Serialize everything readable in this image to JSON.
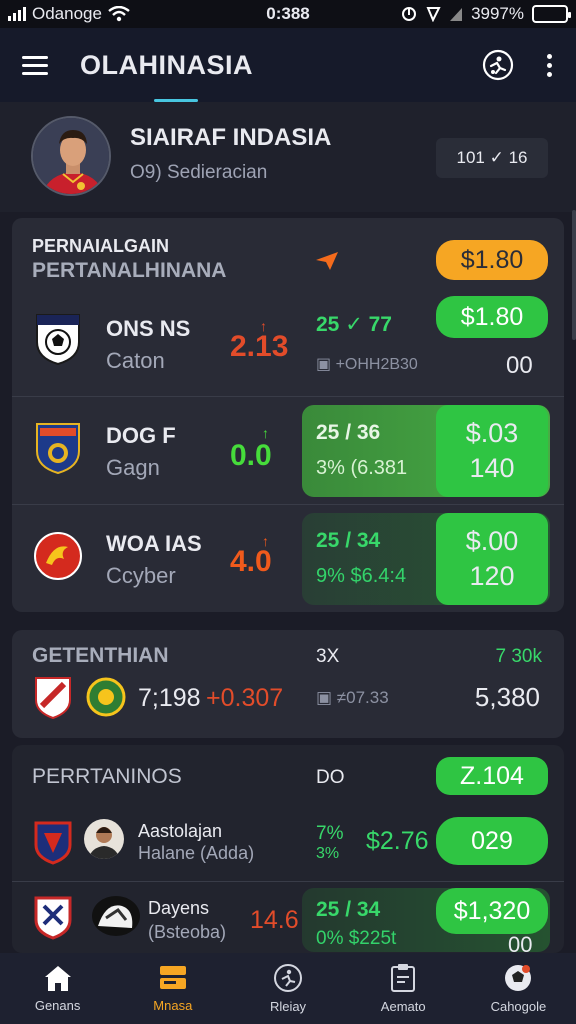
{
  "status_bar": {
    "carrier": "Odanoge",
    "time": "0:388",
    "battery": "3997%",
    "icons": [
      "signal-icon",
      "wifi-icon",
      "sync-icon",
      "location-icon",
      "cellular-icon",
      "battery-icon"
    ]
  },
  "app_bar": {
    "title": "OLAHINASIA",
    "icons": [
      "menu-icon",
      "ball-player-icon",
      "more-icon"
    ],
    "accent": "#48c6e0"
  },
  "profile": {
    "name": "SIAIRAF INDASIA",
    "subtitle": "O9) Sedieracian",
    "stat": "101 ✓ 16"
  },
  "section1": {
    "title": "PERNAIALGAIN",
    "subtitle": "PERTANALHINANA",
    "badge_orange": "$1.80",
    "matches": [
      {
        "team1": "ONS NS",
        "team2": "Caton",
        "score": "2.13",
        "score_mark": "↑",
        "odds_line1": "25 ✓ 77",
        "odds_line2": "▣ +ΟΗΗ2Β30",
        "pill": "$1.80",
        "value": "00"
      },
      {
        "team1": "DOG F",
        "team2": "Gagn",
        "score": "0.0",
        "score_mark": "↑",
        "odds_line1": "25 / 36",
        "odds_line2": "3% (6.381",
        "pill_top": "$.03",
        "pill_bottom": "140"
      },
      {
        "team1": "WOA IAS",
        "team2": "Ccyber",
        "score": "4.0",
        "score_mark": "↑",
        "odds_line1": "25 / 34",
        "odds_line2": "9% $6.4:4",
        "pill_top": "$.00",
        "pill_bottom": "120"
      }
    ]
  },
  "section2": {
    "title": "GETENTHIAN",
    "col1": "3X",
    "col2": "7 30k",
    "score": "7;198",
    "delta": "+0.307",
    "odds": "▣ ≠07.33",
    "total": "5,380"
  },
  "section3": {
    "title": "PERRTANINOS",
    "col1": "DO",
    "pill_header": "Z.104",
    "rows": [
      {
        "name": "Aastolajan",
        "sub": "Halane (Adda)",
        "odds_top": "7%",
        "odds_bottom": "3%",
        "amount": "$2.76",
        "pill": "029"
      },
      {
        "name": "Dayens",
        "sub": "(Bsteoba)",
        "score": "14.6",
        "odds_line1": "25 / 34",
        "odds_line2": "0% $225t",
        "pill": "$1,320",
        "value": "00"
      }
    ]
  },
  "bottom_nav": [
    {
      "label": "Genans",
      "icon": "home-icon",
      "active": false
    },
    {
      "label": "Mnasa",
      "icon": "layers-icon",
      "active": true
    },
    {
      "label": "Rleiay",
      "icon": "soccer-icon",
      "active": false
    },
    {
      "label": "Aemato",
      "icon": "clipboard-icon",
      "active": false
    },
    {
      "label": "Cahogole",
      "icon": "ball-icon",
      "active": false
    }
  ],
  "colors": {
    "background": "#1b1c27",
    "card": "#292b36",
    "green": "#2fc543",
    "orange": "#f6a623",
    "red": "#e24c2a"
  }
}
